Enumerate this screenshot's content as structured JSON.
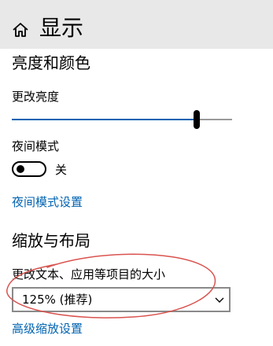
{
  "header": {
    "title": "显示",
    "home_icon": "home-icon"
  },
  "brightness_section": {
    "title": "亮度和颜色",
    "brightness_label": "更改亮度",
    "brightness_value": 0.84,
    "night_light_label": "夜间模式",
    "night_light_state": "关",
    "night_light_on": false,
    "night_light_settings_link": "夜间模式设置"
  },
  "scale_section": {
    "title": "缩放与布局",
    "scale_label": "更改文本、应用等项目的大小",
    "scale_selected": "125% (推荐)",
    "advanced_scaling_link": "高级缩放设置"
  },
  "colors": {
    "accent": "#0063b1",
    "header_bg": "#e8e8e8",
    "annotation": "#d9534f"
  }
}
